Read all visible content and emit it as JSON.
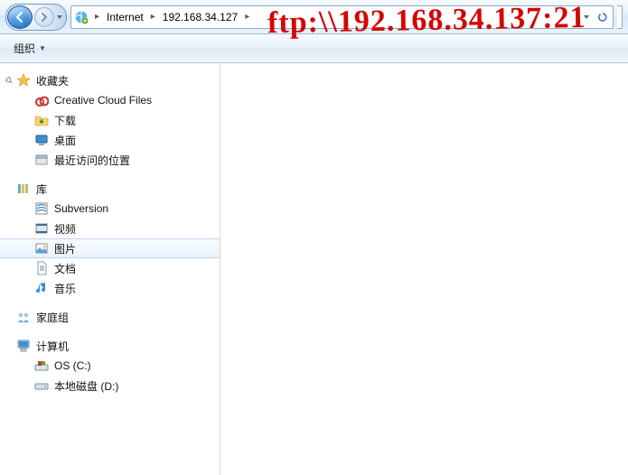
{
  "nav": {
    "crumb1": "Internet",
    "crumb2": "192.168.34.127"
  },
  "toolbar": {
    "organize": "组织"
  },
  "tree": {
    "favorites": {
      "header": "收藏夹",
      "creative_cloud": "Creative Cloud Files",
      "downloads": "下载",
      "desktop": "桌面",
      "recent": "最近访问的位置"
    },
    "libraries": {
      "header": "库",
      "subversion": "Subversion",
      "videos": "视频",
      "pictures": "图片",
      "documents": "文档",
      "music": "音乐"
    },
    "homegroup": {
      "header": "家庭组"
    },
    "computer": {
      "header": "计算机",
      "osc": "OS (C:)",
      "d": "本地磁盘 (D:)"
    }
  },
  "annotation": "ftp:\\\\192.168.34.137:21"
}
